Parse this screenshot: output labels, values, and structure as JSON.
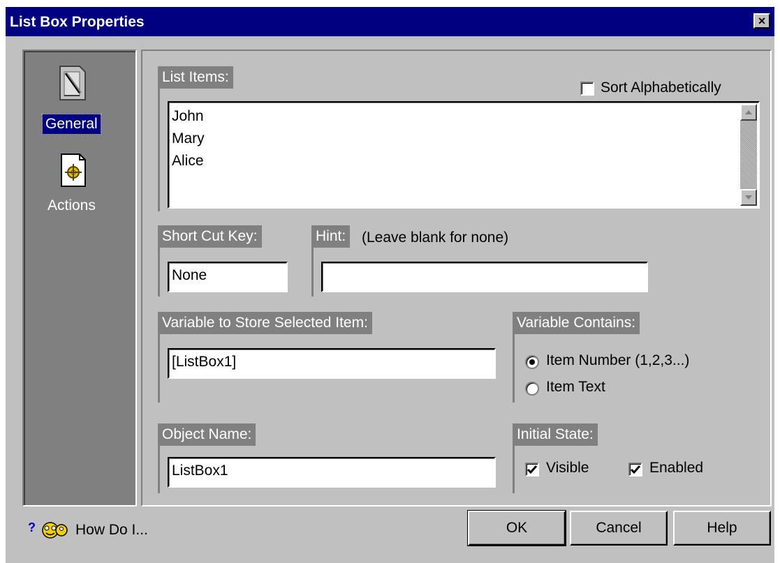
{
  "window": {
    "title": "List Box Properties",
    "close_label": "×"
  },
  "sidebar": {
    "items": [
      {
        "label": "General",
        "icon": "pencil-ruler-document-icon",
        "selected": true
      },
      {
        "label": "Actions",
        "icon": "gear-document-icon",
        "selected": false
      }
    ]
  },
  "list_items": {
    "label": "List Items:",
    "sort_label": "Sort Alphabetically",
    "sort_checked": false,
    "items": [
      "John",
      "Mary",
      "Alice"
    ]
  },
  "shortcut": {
    "label": "Short Cut Key:",
    "value": "None"
  },
  "hint": {
    "label": "Hint:",
    "note": "(Leave blank for none)",
    "value": ""
  },
  "variable": {
    "label": "Variable to Store Selected Item:",
    "value": "[ListBox1]"
  },
  "variable_contains": {
    "label": "Variable Contains:",
    "options": [
      {
        "label": "Item Number (1,2,3...)",
        "selected": true
      },
      {
        "label": "Item Text",
        "selected": false
      }
    ]
  },
  "object_name": {
    "label": "Object Name:",
    "value": "ListBox1"
  },
  "initial_state": {
    "label": "Initial State:",
    "visible_label": "Visible",
    "visible_checked": true,
    "enabled_label": "Enabled",
    "enabled_checked": true
  },
  "footer": {
    "how_do_i": "How Do I...",
    "ok": "OK",
    "cancel": "Cancel",
    "help": "Help"
  },
  "colors": {
    "titlebar": "#000080",
    "face": "#c0c0c0",
    "group_label": "#808080"
  }
}
